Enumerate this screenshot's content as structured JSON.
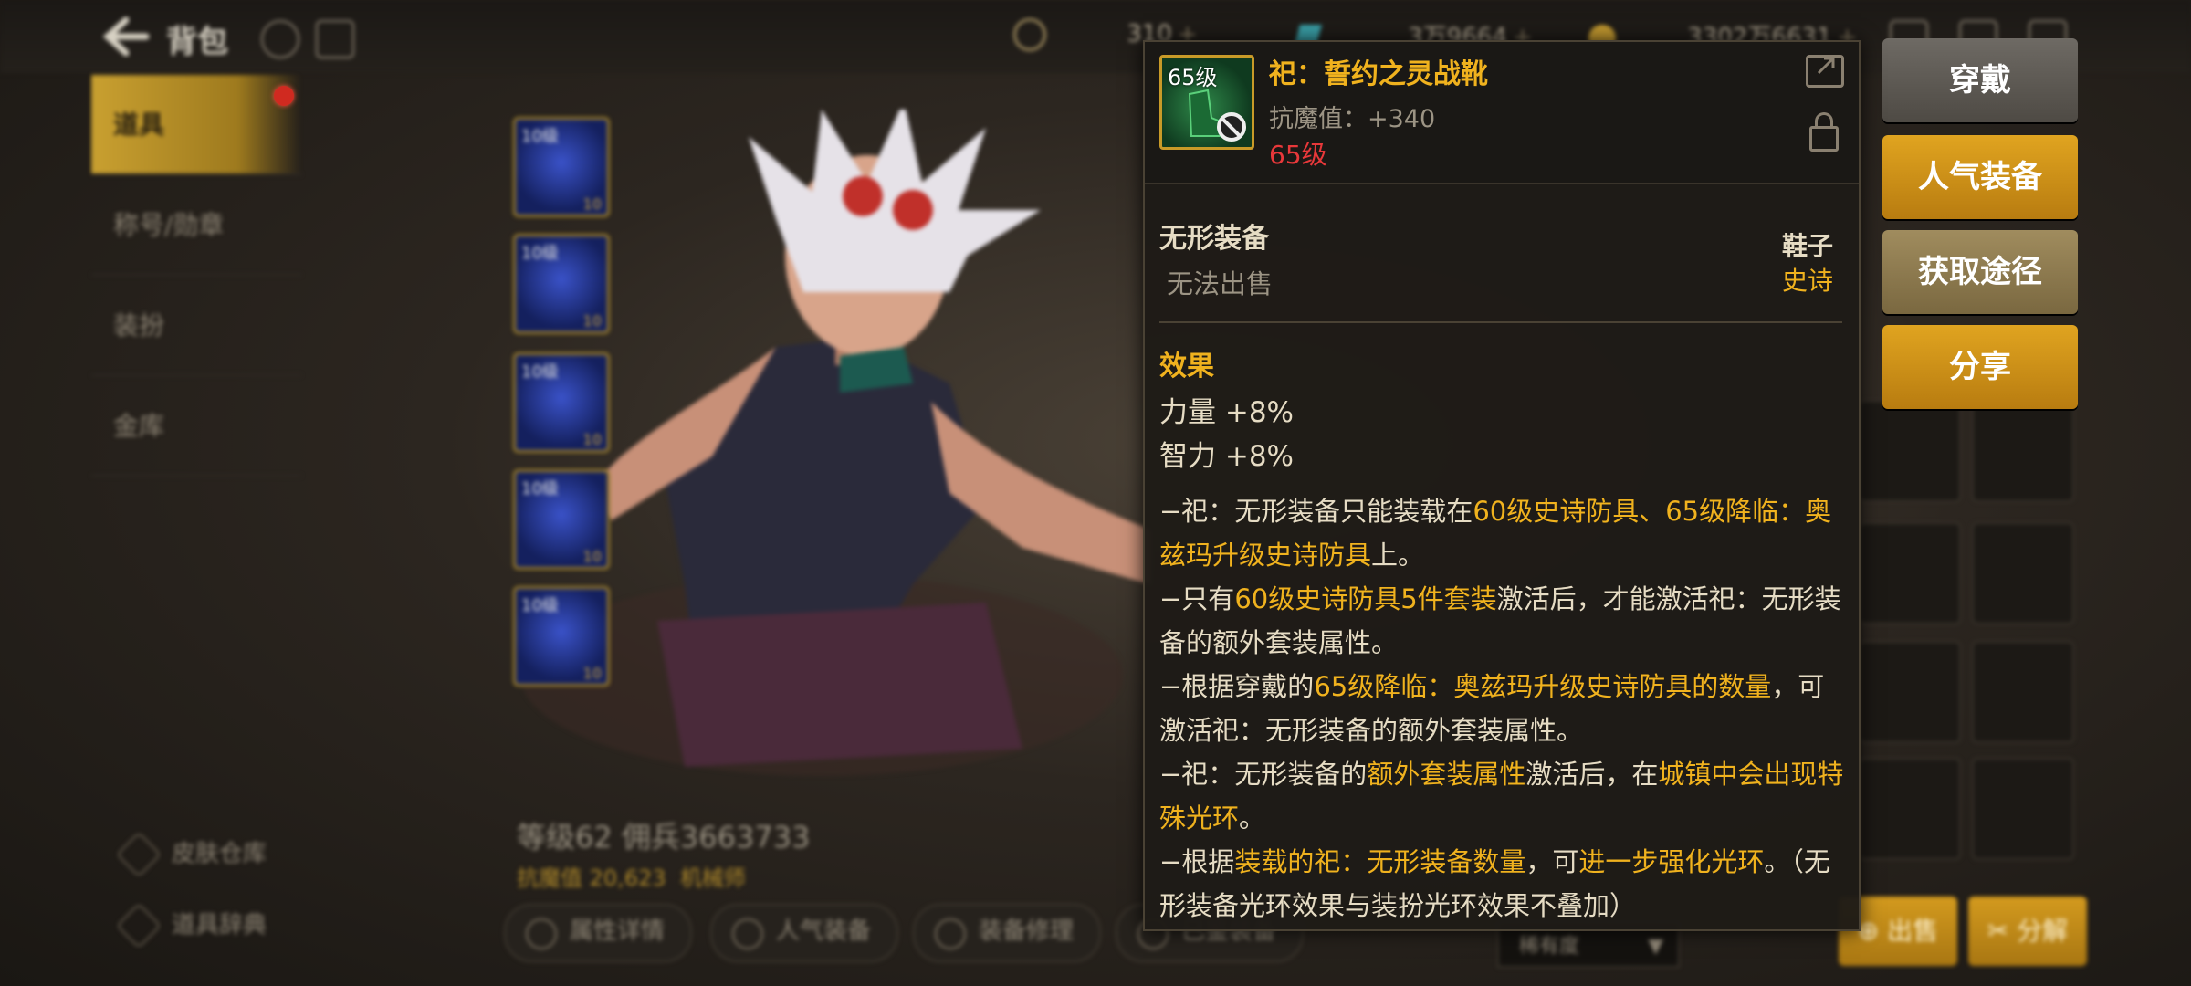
{
  "topbar": {
    "title": "背包",
    "currencies": [
      {
        "icon": "moon-coin-icon",
        "value": "310"
      },
      {
        "icon": "crystal-icon",
        "value": "3万9664"
      },
      {
        "icon": "gold-coin-icon",
        "value": "3302万6631"
      }
    ]
  },
  "sidebar": {
    "items": [
      {
        "label": "道具"
      },
      {
        "label": "称号/勋章"
      },
      {
        "label": "装扮"
      },
      {
        "label": "金库"
      }
    ],
    "links": [
      {
        "label": "皮肤仓库"
      },
      {
        "label": "道具辞典"
      }
    ]
  },
  "slots": [
    {
      "level": "10级",
      "qty": "10"
    },
    {
      "level": "10级",
      "qty": "10"
    },
    {
      "level": "10级",
      "qty": "10"
    },
    {
      "level": "10级",
      "qty": "10"
    },
    {
      "level": "10级",
      "qty": "10"
    }
  ],
  "character": {
    "name": "等级62 佣兵3663733",
    "antimagic": "抗魔值 20,623",
    "job": "机械师"
  },
  "bottom_tabs": [
    {
      "label": "属性详情"
    },
    {
      "label": "人气装备"
    },
    {
      "label": "装备修理"
    },
    {
      "label": "已鉴装备"
    }
  ],
  "rarity_filter": "稀有度",
  "tooltip": {
    "icon_level": "65级",
    "name": "祀：誓约之灵战靴",
    "antimagic": "抗魔值：+340",
    "level": "65级",
    "type": "无形装备",
    "no_sell": "无法出售",
    "slot": "鞋子",
    "rarity": "史诗",
    "effect_title": "效果",
    "stats": [
      "力量 +8%",
      "智力 +8%"
    ],
    "desc": [
      {
        "parts": [
          {
            "t": "−祀：无形装备只能装载在"
          },
          {
            "t": "60级史诗防具、65级降临：奥兹玛升级史诗防具",
            "hl": true
          },
          {
            "t": "上。"
          }
        ]
      },
      {
        "parts": [
          {
            "t": "−只有"
          },
          {
            "t": "60级史诗防具5件套装",
            "hl": true
          },
          {
            "t": "激活后，才能激活祀：无形装备的额外套装属性。"
          }
        ]
      },
      {
        "parts": [
          {
            "t": "−根据穿戴的"
          },
          {
            "t": "65级降临：奥兹玛升级史诗防具的数量",
            "hl": true
          },
          {
            "t": "，可激活祀：无形装备的额外套装属性。"
          }
        ]
      },
      {
        "parts": [
          {
            "t": "−祀：无形装备的"
          },
          {
            "t": "额外套装属性",
            "hl": true
          },
          {
            "t": "激活后，在"
          },
          {
            "t": "城镇中会出现特殊光环",
            "hl": true
          },
          {
            "t": "。"
          }
        ]
      },
      {
        "parts": [
          {
            "t": "−根据"
          },
          {
            "t": "装载的祀：无形装备数量",
            "hl": true
          },
          {
            "t": "，可"
          },
          {
            "t": "进一步强化光环",
            "hl": true
          },
          {
            "t": "。（无形装备光环效果与装扮光环效果不叠加）"
          }
        ]
      }
    ]
  },
  "actions": {
    "wear": "穿戴",
    "popular": "人气装备",
    "source": "获取途径",
    "share": "分享",
    "sell": "出售",
    "decompose": "分解"
  }
}
